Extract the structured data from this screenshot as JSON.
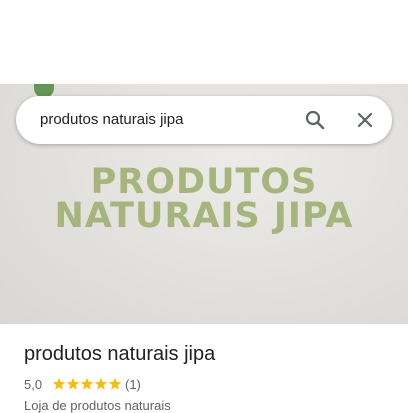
{
  "search": {
    "query": "produtos naturais jipa"
  },
  "hero": {
    "line1": "PRODUTOS",
    "line2": "NATURAIS JIPA"
  },
  "place": {
    "title": "produtos naturais jipa",
    "rating": "5,0",
    "stars": 5,
    "review_count": "(1)",
    "category": "Loja de produtos naturais"
  },
  "colors": {
    "star": "#fbbc04",
    "hero_text": "#a5b57c"
  }
}
